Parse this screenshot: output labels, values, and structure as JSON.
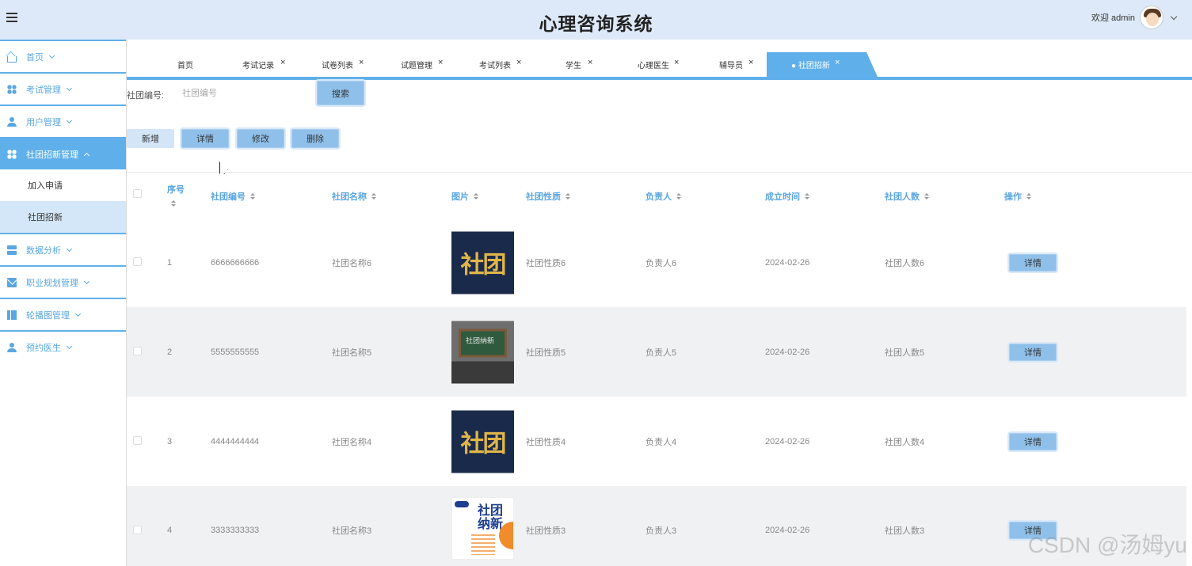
{
  "header": {
    "title": "心理咨询系统",
    "welcome": "欢迎 admin"
  },
  "sidebar": {
    "items": [
      {
        "label": "首页",
        "icon": "home-icon"
      },
      {
        "label": "考试管理",
        "icon": "grid-icon"
      },
      {
        "label": "用户管理",
        "icon": "user-icon"
      },
      {
        "label": "社团招新管理",
        "icon": "grid-icon",
        "active": true,
        "children": [
          {
            "label": "加入申请"
          },
          {
            "label": "社团招新",
            "selected": true
          }
        ]
      },
      {
        "label": "数据分析",
        "icon": "server-icon"
      },
      {
        "label": "职业规划管理",
        "icon": "mail-icon"
      },
      {
        "label": "轮播图管理",
        "icon": "book-icon"
      },
      {
        "label": "预约医生",
        "icon": "user-icon"
      }
    ]
  },
  "tabs": [
    {
      "label": "首页",
      "closable": false
    },
    {
      "label": "考试记录",
      "closable": true
    },
    {
      "label": "试卷列表",
      "closable": true
    },
    {
      "label": "试题管理",
      "closable": true
    },
    {
      "label": "考试列表",
      "closable": true
    },
    {
      "label": "学生",
      "closable": true
    },
    {
      "label": "心理医生",
      "closable": true
    },
    {
      "label": "辅导员",
      "closable": true
    },
    {
      "label": "● 社团招新",
      "closable": true,
      "active": true
    }
  ],
  "close_glyph": "×",
  "search": {
    "label": "社团编号:",
    "placeholder": "社团编号",
    "button": "搜索"
  },
  "toolbar": {
    "add": "新增",
    "detail": "详情",
    "edit": "修改",
    "delete": "删除"
  },
  "table": {
    "headers": [
      "序号",
      "社团编号",
      "社团名称",
      "图片",
      "社团性质",
      "负责人",
      "成立时间",
      "社团人数",
      "操作"
    ],
    "rows": [
      {
        "index": "1",
        "code": "6666666666",
        "name": "社团名称6",
        "image": "社团",
        "nature": "社团性质6",
        "leader": "负责人6",
        "date": "2024-02-26",
        "count": "社团人数6",
        "action": "详情"
      },
      {
        "index": "2",
        "code": "5555555555",
        "name": "社团名称5",
        "image": "社团纳新",
        "nature": "社团性质5",
        "leader": "负责人5",
        "date": "2024-02-26",
        "count": "社团人数5",
        "action": "详情"
      },
      {
        "index": "3",
        "code": "4444444444",
        "name": "社团名称4",
        "image": "社团",
        "nature": "社团性质4",
        "leader": "负责人4",
        "date": "2024-02-26",
        "count": "社团人数4",
        "action": "详情"
      },
      {
        "index": "4",
        "code": "3333333333",
        "name": "社团名称3",
        "image": "社团纳新",
        "nature": "社团性质3",
        "leader": "负责人3",
        "date": "2024-02-26",
        "count": "社团人数3",
        "action": "详情"
      }
    ]
  },
  "watermark": "CSDN @汤姆yu",
  "colors": {
    "accent": "#5fb0ea",
    "header_bg": "#dde9f8",
    "button": "#8fc0ea"
  }
}
